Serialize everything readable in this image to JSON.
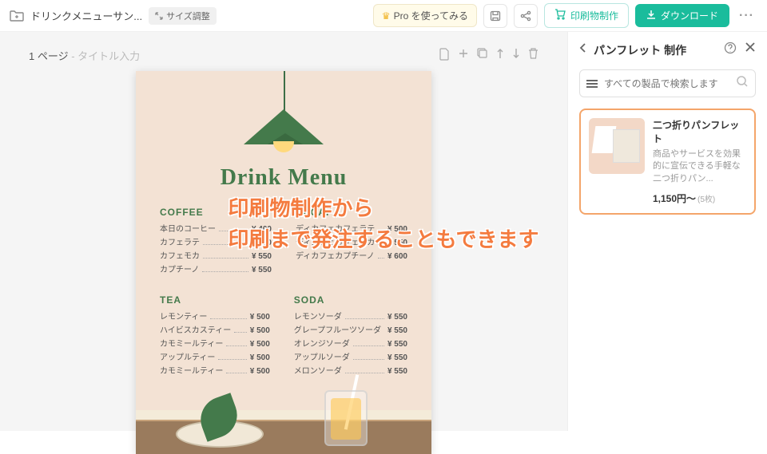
{
  "topbar": {
    "doc_title": "ドリンクメニューサン...",
    "size_label": "サイズ調整",
    "pro_label": "Pro を使ってみる",
    "print_label": "印刷物制作",
    "download_label": "ダウンロード"
  },
  "page_toolbar": {
    "page_label": "1 ページ",
    "title_hint": " - タイトル入力"
  },
  "menu": {
    "title": "Drink Menu",
    "sections": {
      "coffee": {
        "heading": "COFFEE",
        "items": [
          {
            "name": "本日のコーヒー",
            "price": "¥ 400"
          },
          {
            "name": "カフェラテ",
            "price": "¥ 500"
          },
          {
            "name": "カフェモカ",
            "price": "¥ 550"
          },
          {
            "name": "カプチーノ",
            "price": "¥ 550"
          }
        ]
      },
      "decaf": {
        "heading": "DECAF",
        "items": [
          {
            "name": "ディカフェカフェラテ",
            "price": "¥ 500"
          },
          {
            "name": "ディカフェカフェモカ",
            "price": "¥ 550"
          },
          {
            "name": "ディカフェカプチーノ",
            "price": "¥ 600"
          }
        ]
      },
      "tea": {
        "heading": "TEA",
        "items": [
          {
            "name": "レモンティー",
            "price": "¥ 500"
          },
          {
            "name": "ハイビスカスティー",
            "price": "¥ 500"
          },
          {
            "name": "カモミールティー",
            "price": "¥ 500"
          },
          {
            "name": "アップルティー",
            "price": "¥ 500"
          },
          {
            "name": "カモミールティー",
            "price": "¥ 500"
          }
        ]
      },
      "soda": {
        "heading": "SODA",
        "items": [
          {
            "name": "レモンソーダ",
            "price": "¥ 550"
          },
          {
            "name": "グレープフルーツソーダ",
            "price": "¥ 550"
          },
          {
            "name": "オレンジソーダ",
            "price": "¥ 550"
          },
          {
            "name": "アップルソーダ",
            "price": "¥ 550"
          },
          {
            "name": "メロンソーダ",
            "price": "¥ 550"
          }
        ]
      }
    }
  },
  "overlay": {
    "line1": "印刷物制作から",
    "line2": "印刷まで発注することもできます"
  },
  "sidebar": {
    "title": "パンフレット 制作",
    "search_placeholder": "すべての製品で検索します",
    "product": {
      "title": "二つ折りパンフレット",
      "desc": "商品やサービスを効果的に宣伝できる手軽な二つ折りパン...",
      "price": "1,150円〜",
      "unit": "(5枚)"
    }
  }
}
